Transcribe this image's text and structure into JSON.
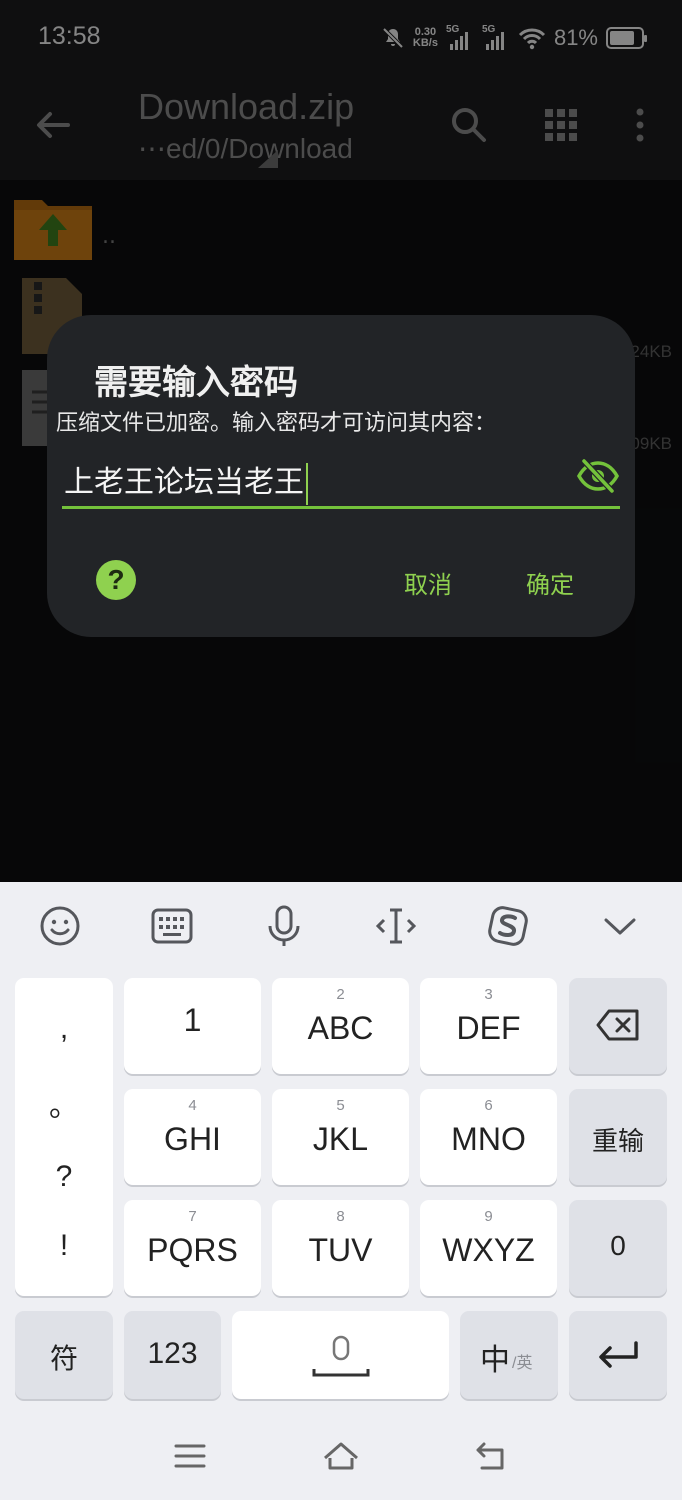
{
  "status_bar": {
    "time": "13:58",
    "net_speed_value": "0.30",
    "net_speed_unit": "KB/s",
    "sim1_label": "5G",
    "sim2_label": "5G",
    "battery_percent": "81%"
  },
  "toolbar": {
    "title": "Download.zip",
    "path": "⋯ed/0/Download"
  },
  "file_list": {
    "items": [
      {
        "name": ".."
      },
      {
        "size": "24KB"
      },
      {
        "size": "09KB"
      }
    ]
  },
  "dialog": {
    "title": "需要输入密码",
    "message": "压缩文件已加密。输入密码才可访问其内容：",
    "password_value": "上老王论坛当老王",
    "help_label": "?",
    "cancel_label": "取消",
    "ok_label": "确定"
  },
  "keyboard": {
    "punct": [
      ",",
      "。",
      "?",
      "!"
    ],
    "row1": [
      {
        "num": "",
        "label": "1"
      },
      {
        "num": "2",
        "label": "ABC"
      },
      {
        "num": "3",
        "label": "DEF"
      }
    ],
    "row2": [
      {
        "num": "4",
        "label": "GHI"
      },
      {
        "num": "5",
        "label": "JKL"
      },
      {
        "num": "6",
        "label": "MNO"
      }
    ],
    "row3": [
      {
        "num": "7",
        "label": "PQRS"
      },
      {
        "num": "8",
        "label": "TUV"
      },
      {
        "num": "9",
        "label": "WXYZ"
      }
    ],
    "reenter_label": "重输",
    "zero_label": "0",
    "symbols_label": "符",
    "numbers_label": "123",
    "lang_main": "中",
    "lang_alt": "/英"
  },
  "colors": {
    "accent": "#8fd14f",
    "dialog_bg": "#222427",
    "keyboard_bg": "#eeeff3"
  }
}
